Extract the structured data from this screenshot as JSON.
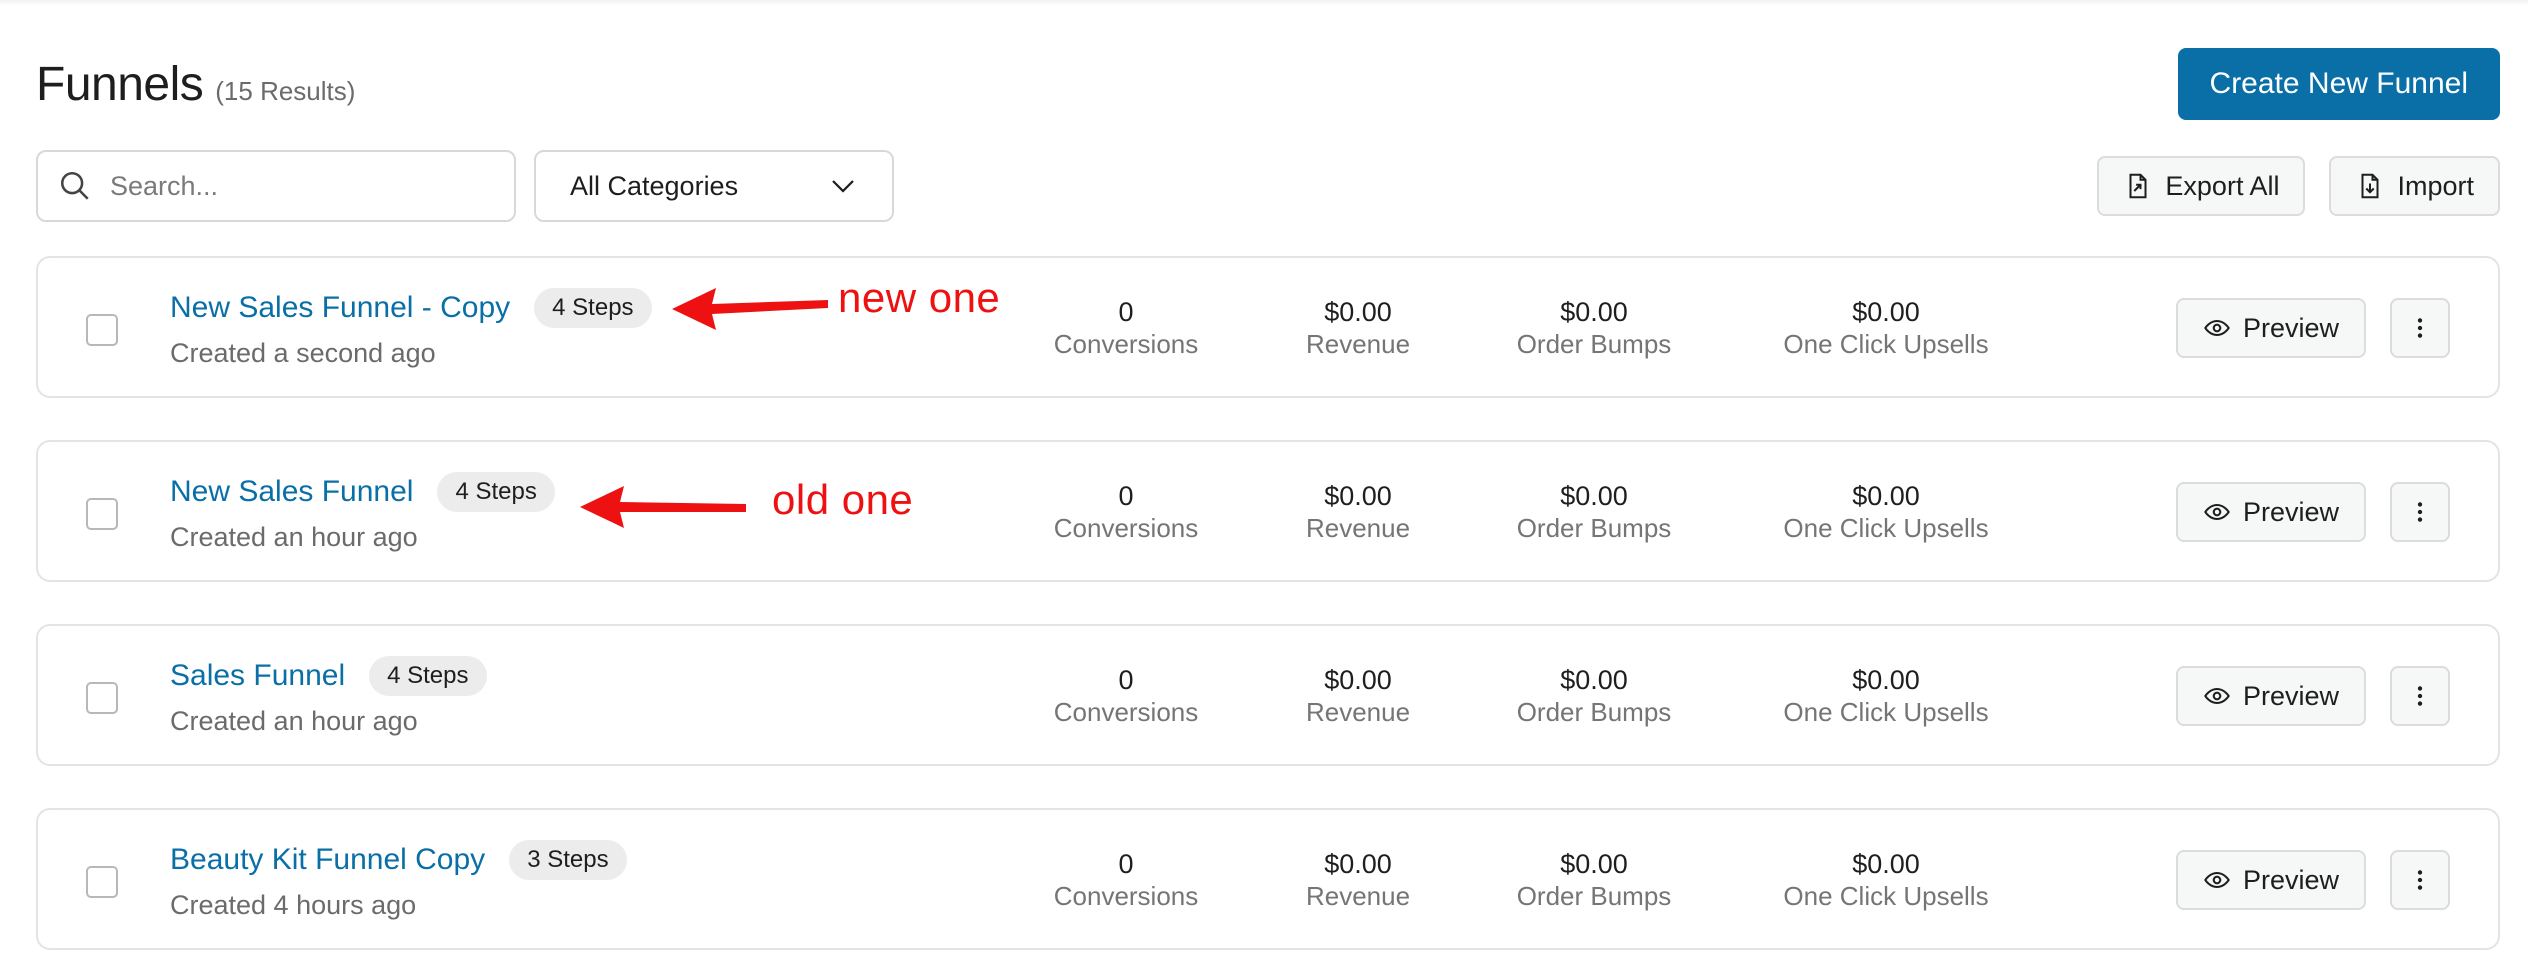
{
  "header": {
    "title": "Funnels",
    "result_count": "(15 Results)",
    "create_button_label": "Create New Funnel"
  },
  "toolbar": {
    "search_placeholder": "Search...",
    "category_selected": "All Categories",
    "export_label": "Export All",
    "import_label": "Import"
  },
  "stat_labels": {
    "conversions": "Conversions",
    "revenue": "Revenue",
    "order_bumps": "Order Bumps",
    "one_click_upsells": "One Click Upsells"
  },
  "row_actions": {
    "preview_label": "Preview"
  },
  "funnels": [
    {
      "name": "New Sales Funnel - Copy",
      "steps": "4 Steps",
      "created": "Created a second ago",
      "conversions": "0",
      "revenue": "$0.00",
      "order_bumps": "$0.00",
      "one_click_upsells": "$0.00"
    },
    {
      "name": "New Sales Funnel",
      "steps": "4 Steps",
      "created": "Created an hour ago",
      "conversions": "0",
      "revenue": "$0.00",
      "order_bumps": "$0.00",
      "one_click_upsells": "$0.00"
    },
    {
      "name": "Sales Funnel",
      "steps": "4 Steps",
      "created": "Created an hour ago",
      "conversions": "0",
      "revenue": "$0.00",
      "order_bumps": "$0.00",
      "one_click_upsells": "$0.00"
    },
    {
      "name": "Beauty Kit Funnel Copy",
      "steps": "3 Steps",
      "created": "Created 4 hours ago",
      "conversions": "0",
      "revenue": "$0.00",
      "order_bumps": "$0.00",
      "one_click_upsells": "$0.00"
    }
  ],
  "annotations": {
    "new_label": "new one",
    "old_label": "old one",
    "color": "#ee1111"
  },
  "colors": {
    "primary": "#0a6fa6",
    "link": "#0a6fa6"
  },
  "icons": {
    "search": "search-icon",
    "dropdown": "chevron-down-icon",
    "export": "export-icon",
    "import": "import-icon",
    "preview": "eye-icon",
    "more": "more-vertical-icon"
  }
}
